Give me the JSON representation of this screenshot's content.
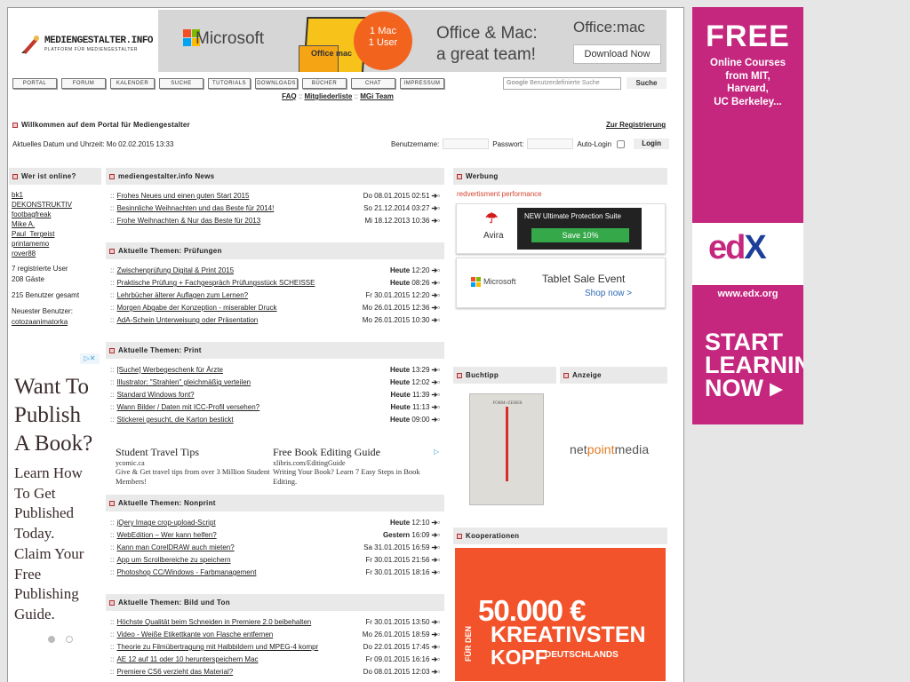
{
  "logo": {
    "title": "MEDIENGESTALTER.INFO",
    "subtitle": "PLATFORM FÜR MEDIENGESTALTER"
  },
  "ms_banner": {
    "brand": "Microsoft",
    "box_label": "Office mac",
    "badge_line1": "1 Mac",
    "badge_line2": "1 User",
    "tagline_line1": "Office & Mac:",
    "tagline_line2": "a great team!",
    "product": "Office:mac",
    "button": "Download Now"
  },
  "nav": [
    "PORTAL",
    "FORUM",
    "KALENDER",
    "SUCHE",
    "TUTORIALS",
    "DOWNLOADS",
    "BÜCHER",
    "CHAT",
    "IMPRESSUM"
  ],
  "search": {
    "brand": "Google",
    "placeholder": "Benutzerdefinierte Suche",
    "button": "Suche"
  },
  "sublinks": [
    "FAQ",
    "Mitgliederliste",
    "MGi Team"
  ],
  "sublink_sep": "::",
  "welcome": "Willkommen auf dem Portal für Mediengestalter",
  "register": "Zur Registrierung",
  "datetime": "Aktuelles Datum und Uhrzeit: Mo 02.02.2015 13:33",
  "login": {
    "user_label": "Benutzername:",
    "pass_label": "Passwort:",
    "auto_label": "Auto-Login",
    "button": "Login"
  },
  "online": {
    "title": "Wer ist online?",
    "users": [
      "bk1",
      "DEKONSTRUKTIV",
      "footbagfreak",
      "Mike A.",
      "Paul_Tergeist",
      "printamemo",
      "rover88"
    ],
    "registered": "7 registrierte User",
    "guests": "208 Gäste",
    "total": "215 Benutzer gesamt",
    "newest_label": "Neuester Benutzer:",
    "newest_user": "cotozaanimatorka"
  },
  "left_ad": {
    "big_lines": [
      "Want To",
      "Publish",
      "A Book?"
    ],
    "small_lines": [
      "Learn How",
      "To Get",
      "Published",
      "Today.",
      "Claim Your",
      "Free",
      "Publishing",
      "Guide."
    ]
  },
  "sections": [
    {
      "title": "mediengestalter.info News",
      "items": [
        {
          "title": "Frohes Neues und einen guten Start 2015",
          "day": "Do",
          "date": "08.01.2015",
          "time": "02:51"
        },
        {
          "title": "Besinnliche Weihnachten und das Beste für 2014!",
          "day": "So",
          "date": "21.12.2014",
          "time": "03:27"
        },
        {
          "title": "Frohe Weihnachten & Nur das Beste für 2013",
          "day": "Mi",
          "date": "18.12.2013",
          "time": "10:36"
        }
      ]
    },
    {
      "title": "Aktuelle Themen: Prüfungen",
      "items": [
        {
          "title": "Zwischenprüfung Digital & Print 2015",
          "day": "Heute",
          "date": "",
          "time": "12:20"
        },
        {
          "title": "Praktische Prüfung + Fachgespräch Prüfungsstück SCHEISSE",
          "day": "Heute",
          "date": "",
          "time": "08:26"
        },
        {
          "title": "Lehrbücher älterer Auflagen zum Lernen?",
          "day": "Fr",
          "date": "30.01.2015",
          "time": "12:20"
        },
        {
          "title": "Morgen Abgabe der Konzeption - miserabler Druck",
          "day": "Mo",
          "date": "26.01.2015",
          "time": "12:36"
        },
        {
          "title": "AdA-Schein Unterweisung oder Präsentation",
          "day": "Mo",
          "date": "26.01.2015",
          "time": "10:30"
        }
      ]
    },
    {
      "title": "Aktuelle Themen: Print",
      "items": [
        {
          "title": "[Suche] Werbegeschenk für Ärzte",
          "day": "Heute",
          "date": "",
          "time": "13:29"
        },
        {
          "title": "Illustrator: \"Strahlen\" gleichmäßig verteilen",
          "day": "Heute",
          "date": "",
          "time": "12:02"
        },
        {
          "title": "Standard Windows font?",
          "day": "Heute",
          "date": "",
          "time": "11:39"
        },
        {
          "title": "Wann Bilder / Daten mit ICC-Profil versehen?",
          "day": "Heute",
          "date": "",
          "time": "11:13"
        },
        {
          "title": "Stickerei gesucht, die Karton bestickt",
          "day": "Heute",
          "date": "",
          "time": "09:00"
        }
      ]
    },
    {
      "title": "Aktuelle Themen: Nonprint",
      "items": [
        {
          "title": "jQery Image crop-upload-Script",
          "day": "Heute",
          "date": "",
          "time": "12:10"
        },
        {
          "title": "WebEdition – Wer kann helfen?",
          "day": "Gestern",
          "date": "",
          "time": "16:09"
        },
        {
          "title": "Kann man CorelDRAW auch mieten?",
          "day": "Sa",
          "date": "31.01.2015",
          "time": "16:59"
        },
        {
          "title": "App um Scrollbereiche zu speichern",
          "day": "Fr",
          "date": "30.01.2015",
          "time": "21:56"
        },
        {
          "title": "Photoshop CC/Windows - Farbmanagement",
          "day": "Fr",
          "date": "30.01.2015",
          "time": "18:16"
        }
      ]
    },
    {
      "title": "Aktuelle Themen: Bild und Ton",
      "items": [
        {
          "title": "Höchste Qualität beim Schneiden in Premiere 2.0 beibehalten",
          "day": "Fr",
          "date": "30.01.2015",
          "time": "13:50"
        },
        {
          "title": "Video - Weiße Etikettkante von Flasche entfernen",
          "day": "Mo",
          "date": "26.01.2015",
          "time": "18:59"
        },
        {
          "title": "Theorie zu Filmübertragung mit Halbbildern und MPEG-4 kompr",
          "day": "Do",
          "date": "22.01.2015",
          "time": "17:45"
        },
        {
          "title": "AE 12 auf 11 oder 10 herunterspeichern Mac",
          "day": "Fr",
          "date": "09.01.2015",
          "time": "16:16"
        },
        {
          "title": "Premiere CS6 verzieht das Material?",
          "day": "Do",
          "date": "08.01.2015",
          "time": "12:03"
        }
      ]
    }
  ],
  "mid_ad": {
    "a_title": "Student Travel Tips",
    "a_url": "ycomic.ca",
    "a_desc": "Give & Get travel tips from over 3 Million Student Members!",
    "b_title": "Free Book Editing Guide",
    "b_url": "xlibris.com/EditingGuide",
    "b_desc": "Writing Your Book? Learn 7 Easy Steps in Book Editing."
  },
  "werbung": {
    "title": "Werbung",
    "text": "redvertisment performance"
  },
  "avira": {
    "name": "Avira",
    "promo": "NEW Ultimate Protection Suite",
    "button": "Save 10%"
  },
  "mstab": {
    "brand": "Microsoft",
    "title": "Tablet Sale Event",
    "link": "Shop now >"
  },
  "buchtipp": {
    "title": "Buchtipp",
    "book_title": "FORM+ZEHER"
  },
  "anzeige": {
    "title": "Anzeige",
    "brand_a": "net",
    "brand_b": "point",
    "brand_c": "media"
  },
  "koop": {
    "title": "Kooperationen",
    "amount": "50.000 €",
    "line1": "KREATIVSTEN",
    "line2": "KOPF",
    "line3": "DEUTSCHLANDS",
    "side": "FÜR DEN"
  },
  "edx": {
    "free": "FREE",
    "sub_lines": [
      "Online Courses",
      "from MIT,",
      "Harvard,",
      "UC Berkeley..."
    ],
    "logo_a": "ed",
    "logo_b": "X",
    "url": "www.edx.org",
    "cta_lines": [
      "START",
      "LEARNING",
      "NOW ▸"
    ]
  },
  "colors": {
    "accent_red": "#b03030",
    "edx_pink": "#c5277f",
    "koop_orange": "#f2532a"
  }
}
